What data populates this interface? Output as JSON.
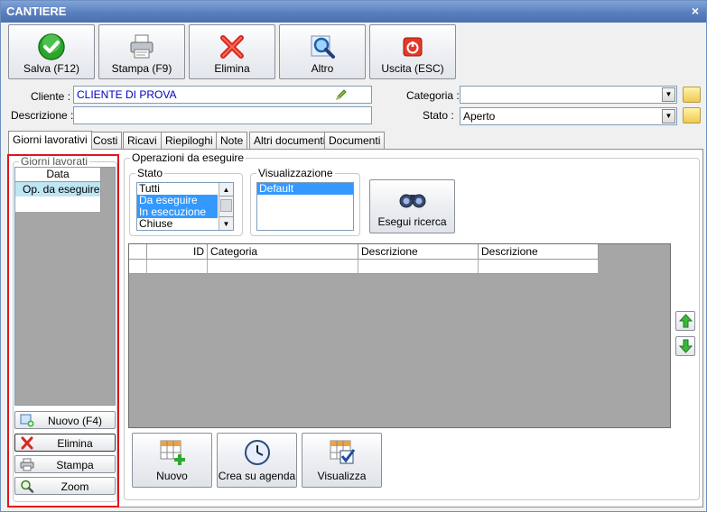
{
  "window": {
    "title": "CANTIERE",
    "close_glyph": "×"
  },
  "toolbar": [
    {
      "label": "Salva (F12)",
      "icon": "check-icon"
    },
    {
      "label": "Stampa (F9)",
      "icon": "printer-icon"
    },
    {
      "label": "Elimina",
      "icon": "red-x-icon"
    },
    {
      "label": "Altro",
      "icon": "magnifier-icon"
    },
    {
      "label": "Uscita (ESC)",
      "icon": "power-icon"
    }
  ],
  "form": {
    "cliente_label": "Cliente :",
    "cliente_value": "CLIENTE DI PROVA",
    "descrizione_label": "Descrizione :",
    "descrizione_value": "",
    "categoria_label": "Categoria :",
    "categoria_value": "",
    "stato_label": "Stato :",
    "stato_value": "Aperto"
  },
  "tabs": [
    "Giorni lavorativi",
    "Costi",
    "Ricavi",
    "Riepiloghi",
    "Note",
    "Altri documenti",
    "Documenti"
  ],
  "giorni": {
    "group_title": "Giorni lavorati",
    "header": "Data",
    "rows": [
      "Op. da eseguire"
    ],
    "buttons": [
      "Nuovo (F4)",
      "Elimina",
      "Stampa",
      "Zoom"
    ]
  },
  "operazioni": {
    "group_title": "Operazioni da eseguire",
    "stato_title": "Stato",
    "stato_items": [
      {
        "label": "Tutti",
        "selected": false
      },
      {
        "label": "Da eseguire",
        "selected": true
      },
      {
        "label": "In esecuzione",
        "selected": true
      },
      {
        "label": "Chiuse",
        "selected": false
      }
    ],
    "vis_title": "Visualizzazione",
    "vis_items": [
      {
        "label": "Default",
        "selected": true
      }
    ],
    "search_button": "Esegui ricerca",
    "columns": [
      "",
      "ID",
      "Categoria",
      "Descrizione",
      "Descrizione"
    ],
    "bottom_buttons": [
      "Nuovo",
      "Crea su agenda",
      "Visualizza"
    ]
  }
}
